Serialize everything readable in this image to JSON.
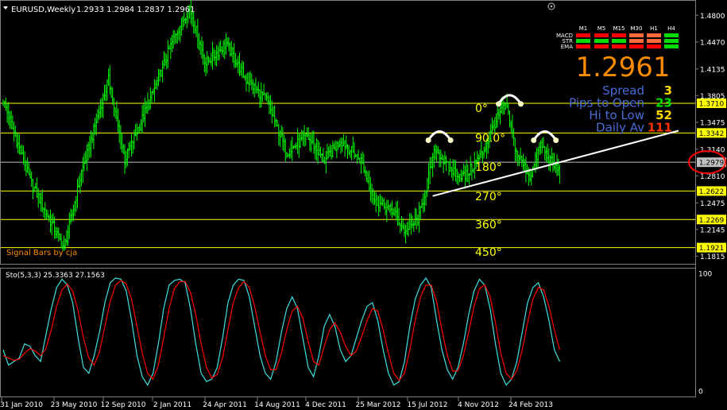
{
  "header": {
    "symbol_label": "EURUSD,Weekly",
    "ohlc": "1.2933 1.2984 1.2837 1.2961"
  },
  "watermark": "Signal Bars by cja",
  "panel": {
    "timeframes": [
      "M1",
      "M5",
      "M15",
      "M30",
      "H1",
      "H4"
    ],
    "rows": [
      {
        "name": "MACD",
        "colors": [
          "#ff0000",
          "#ff0000",
          "#ff0000",
          "#ff6a3a",
          "#ff6a3a",
          "#00dd00"
        ]
      },
      {
        "name": "STR",
        "colors": [
          "#00dd00",
          "#00dd00",
          "#00dd00",
          "#ff6a3a",
          "#ff6a3a",
          "#00dd00"
        ]
      },
      {
        "name": "EMA",
        "colors": [
          "#ff0000",
          "#ff0000",
          "#ff0000",
          "#ff0000",
          "#ff0000",
          "#00dd00"
        ]
      }
    ],
    "price": "1.2961",
    "stats": [
      {
        "label": "Spread",
        "value": "3",
        "color": "#ffd700"
      },
      {
        "label": "Pips to Open",
        "value": "23",
        "color": "#00dd00"
      },
      {
        "label": "Hi to Low",
        "value": "52",
        "color": "#ffd700"
      },
      {
        "label": "Daily Av",
        "value": "111",
        "color": "#ff3300"
      }
    ],
    "label_color": "#4a6cd4",
    "price_color": "#ff8c00"
  },
  "chart_data": [
    {
      "type": "bar",
      "subtype": "ohlc",
      "series_color": "#00ff00",
      "x_tick_labels": [
        "31 Jan 2010",
        "23 May 2010",
        "12 Sep 2010",
        "2 Jan 2011",
        "24 Apr 2011",
        "14 Aug 2011",
        "4 Dec 2011",
        "25 Mar 2012",
        "15 Jul 2012",
        "4 Nov 2012",
        "24 Feb 2013"
      ],
      "y_ticks": [
        1.48,
        1.447,
        1.4135,
        1.3805,
        1.3475,
        1.314,
        1.281,
        1.2475,
        1.2145,
        1.1815
      ],
      "ylim": [
        1.172,
        1.499
      ],
      "key_points": [
        {
          "x": 0,
          "y": 1.375
        },
        {
          "x": 20,
          "y": 1.275
        },
        {
          "x": 38,
          "y": 1.215
        },
        {
          "x": 45,
          "y": 1.19
        },
        {
          "x": 58,
          "y": 1.285
        },
        {
          "x": 78,
          "y": 1.4
        },
        {
          "x": 90,
          "y": 1.3
        },
        {
          "x": 110,
          "y": 1.38
        },
        {
          "x": 127,
          "y": 1.455
        },
        {
          "x": 138,
          "y": 1.49
        },
        {
          "x": 150,
          "y": 1.42
        },
        {
          "x": 165,
          "y": 1.445
        },
        {
          "x": 180,
          "y": 1.4
        },
        {
          "x": 195,
          "y": 1.375
        },
        {
          "x": 210,
          "y": 1.31
        },
        {
          "x": 225,
          "y": 1.33
        },
        {
          "x": 238,
          "y": 1.3
        },
        {
          "x": 250,
          "y": 1.325
        },
        {
          "x": 265,
          "y": 1.3
        },
        {
          "x": 275,
          "y": 1.25
        },
        {
          "x": 290,
          "y": 1.235
        },
        {
          "x": 298,
          "y": 1.21
        },
        {
          "x": 308,
          "y": 1.23
        },
        {
          "x": 320,
          "y": 1.315
        },
        {
          "x": 330,
          "y": 1.29
        },
        {
          "x": 342,
          "y": 1.28
        },
        {
          "x": 355,
          "y": 1.31
        },
        {
          "x": 365,
          "y": 1.35
        },
        {
          "x": 372,
          "y": 1.37
        },
        {
          "x": 380,
          "y": 1.31
        },
        {
          "x": 390,
          "y": 1.28
        },
        {
          "x": 398,
          "y": 1.32
        },
        {
          "x": 405,
          "y": 1.3
        },
        {
          "x": 412,
          "y": 1.285
        }
      ],
      "horizontal_levels": [
        {
          "value": 1.371,
          "label": "1.3710",
          "color": "#ffff00"
        },
        {
          "value": 1.3342,
          "label": "1.3342",
          "color": "#ffff00"
        },
        {
          "value": 1.2979,
          "label": "1.2979",
          "color": "#c0c0c0"
        },
        {
          "value": 1.2622,
          "label": "1.2622",
          "color": "#ffff00"
        },
        {
          "value": 1.2269,
          "label": "1.2269",
          "color": "#ffff00"
        },
        {
          "value": 1.1921,
          "label": "1.1921",
          "color": "#ffff00"
        }
      ],
      "angle_labels": [
        {
          "text": "0°",
          "level": 1.36
        },
        {
          "text": "90.0°",
          "level": 1.323
        },
        {
          "text": "180°",
          "level": 1.287
        },
        {
          "text": "270°",
          "level": 1.251
        },
        {
          "text": "360°",
          "level": 1.216
        },
        {
          "text": "450°",
          "level": 1.182
        }
      ],
      "trendline": {
        "x0": 318,
        "y0": 1.256,
        "x1": 500,
        "y1": 1.337,
        "color": "#ffffff"
      },
      "pattern_arcs": [
        {
          "x": 323,
          "top": 1.335,
          "label": "left-shoulder"
        },
        {
          "x": 375,
          "top": 1.38,
          "label": "head"
        },
        {
          "x": 401,
          "top": 1.335,
          "label": "right-shoulder"
        }
      ],
      "highlight_level": "1.2979",
      "highlight_color": "#ff0000"
    },
    {
      "type": "line",
      "title": "Sto(5,3,3) 25.3363 27.1563",
      "ylim": [
        0,
        100
      ],
      "y_ticks": [
        100,
        0
      ],
      "series": [
        {
          "name": "main",
          "color": "#40e0e0",
          "values": [
            35,
            22,
            25,
            28,
            40,
            38,
            30,
            25,
            48,
            70,
            88,
            95,
            90,
            75,
            45,
            20,
            15,
            30,
            50,
            75,
            92,
            96,
            95,
            85,
            60,
            30,
            12,
            5,
            15,
            40,
            70,
            90,
            94,
            95,
            92,
            70,
            40,
            15,
            8,
            10,
            20,
            45,
            75,
            90,
            95,
            94,
            80,
            55,
            30,
            15,
            10,
            25,
            50,
            70,
            80,
            70,
            45,
            20,
            12,
            30,
            55,
            65,
            55,
            35,
            25,
            30,
            45,
            60,
            72,
            75,
            60,
            35,
            15,
            5,
            8,
            25,
            55,
            78,
            90,
            96,
            88,
            60,
            35,
            18,
            10,
            20,
            40,
            65,
            85,
            95,
            90,
            70,
            40,
            15,
            5,
            10,
            25,
            50,
            75,
            88,
            92,
            80,
            60,
            35,
            25
          ]
        },
        {
          "name": "signal",
          "color": "#ff0000",
          "values": [
            30,
            28,
            26,
            27,
            32,
            36,
            34,
            30,
            36,
            52,
            72,
            86,
            91,
            85,
            68,
            45,
            28,
            22,
            33,
            55,
            76,
            90,
            94,
            91,
            78,
            55,
            32,
            15,
            10,
            22,
            45,
            70,
            87,
            93,
            93,
            84,
            65,
            40,
            20,
            11,
            14,
            28,
            52,
            75,
            88,
            93,
            88,
            72,
            50,
            30,
            18,
            18,
            32,
            52,
            68,
            72,
            62,
            42,
            25,
            22,
            38,
            52,
            58,
            50,
            38,
            30,
            34,
            46,
            60,
            70,
            68,
            52,
            32,
            15,
            9,
            15,
            35,
            60,
            80,
            90,
            90,
            76,
            52,
            30,
            17,
            17,
            30,
            50,
            72,
            87,
            90,
            80,
            58,
            32,
            15,
            10,
            17,
            35,
            58,
            78,
            88,
            86,
            72,
            52,
            35
          ]
        }
      ]
    }
  ]
}
